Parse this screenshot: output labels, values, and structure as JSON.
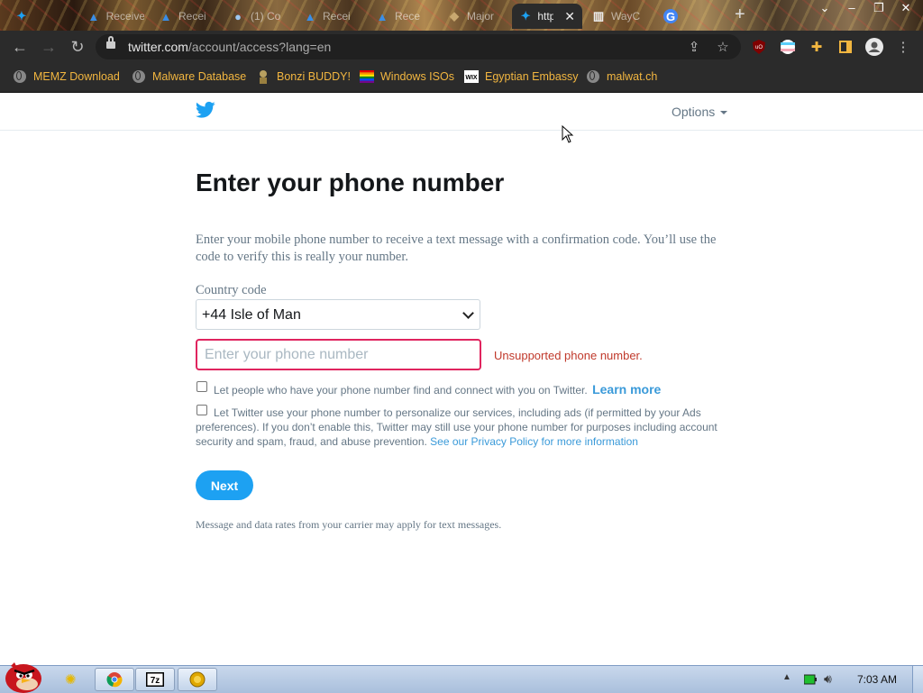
{
  "browser": {
    "tabs": [
      {
        "label": "",
        "icon": "twitter-icon"
      },
      {
        "label": "Receive",
        "icon": "azure-icon"
      },
      {
        "label": "Recei",
        "icon": "azure-icon"
      },
      {
        "label": "(1) Co",
        "icon": "chat-icon"
      },
      {
        "label": "Recei",
        "icon": "azure-icon"
      },
      {
        "label": "Rece",
        "icon": "azure-icon"
      },
      {
        "label": "Major",
        "icon": "puzzle-icon"
      },
      {
        "label": "http",
        "icon": "twitter-icon",
        "active": true
      },
      {
        "label": "WayC",
        "icon": "archive-icon"
      },
      {
        "label": "",
        "icon": "google-icon"
      }
    ],
    "url_host": "twitter.com",
    "url_rest": "/account/access?lang=en",
    "bookmarks": [
      {
        "label": "MEMZ Download",
        "icon": "globe-icon"
      },
      {
        "label": "Malware Database",
        "icon": "globe-icon"
      },
      {
        "label": "Bonzi BUDDY!",
        "icon": "bonzi-icon"
      },
      {
        "label": "Windows ISOs",
        "icon": "windows-flag-icon"
      },
      {
        "label": "Egyptian Embassy",
        "icon": "wix-icon"
      },
      {
        "label": "malwat.ch",
        "icon": "globe-icon"
      }
    ]
  },
  "page": {
    "options_label": "Options",
    "heading": "Enter your phone number",
    "description": "Enter your mobile phone number to receive a text message with a confirmation code. You’ll use the code to verify this is really your number.",
    "country_code_label": "Country code",
    "country_code_value": "+44 Isle of Man",
    "phone_placeholder": "Enter your phone number",
    "phone_error": "Unsupported phone number.",
    "checkbox1_text": "Let people who have your phone number find and connect with you on Twitter.",
    "learn_more": "Learn more",
    "checkbox2_text": "Let Twitter use your phone number to personalize our services, including ads (if permitted by your Ads preferences). If you don’t enable this, Twitter may still use your phone number for purposes including account security and spam, fraud, and abuse prevention.",
    "privacy_link": "See our Privacy Policy for more information",
    "next_button": "Next",
    "footnote": "Message and data rates from your carrier may apply for text messages."
  },
  "taskbar": {
    "clock": "7:03 AM"
  },
  "colors": {
    "twitter_blue": "#1da1f2",
    "error_red": "#e0245e",
    "bookmark_text": "#f2b640"
  }
}
